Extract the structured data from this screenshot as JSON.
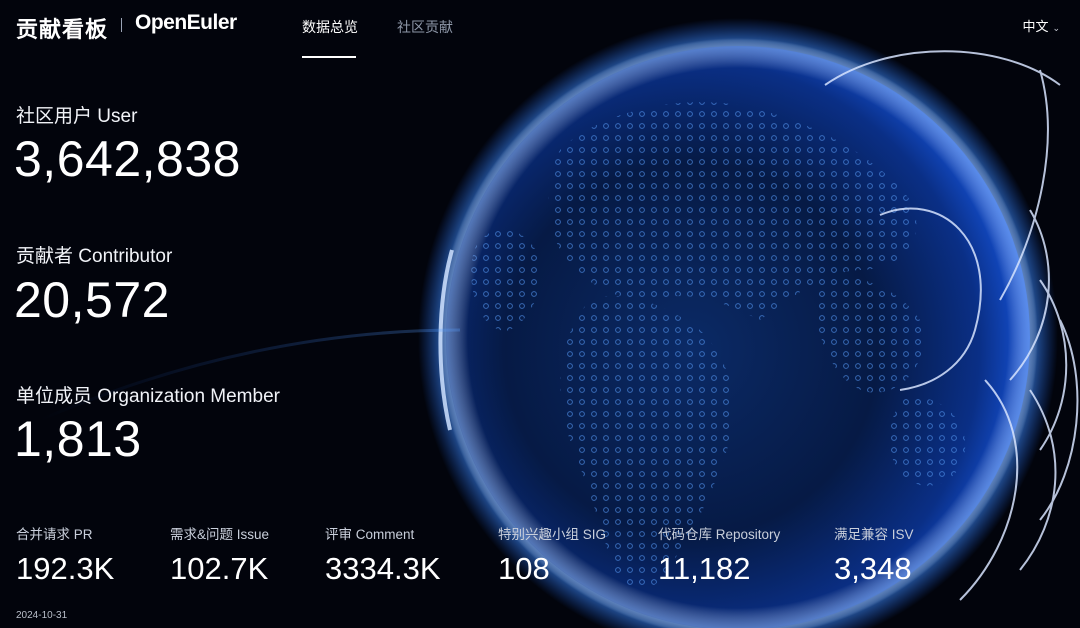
{
  "header": {
    "brand_title": "贡献看板",
    "logo_text": "OpenEuler",
    "tabs": [
      {
        "label": "数据总览",
        "active": true
      },
      {
        "label": "社区贡献",
        "active": false
      }
    ],
    "language": "中文"
  },
  "stats": [
    {
      "label": "社区用户 User",
      "value": "3,642,838"
    },
    {
      "label": "贡献者 Contributor",
      "value": "20,572"
    },
    {
      "label": "单位成员 Organization Member",
      "value": "1,813"
    }
  ],
  "metrics": [
    {
      "label": "合并请求 PR",
      "value": "192.3K"
    },
    {
      "label": "需求&问题 Issue",
      "value": "102.7K"
    },
    {
      "label": "评审 Comment",
      "value": "3334.3K"
    },
    {
      "label": "特别兴趣小组 SIG",
      "value": "108"
    },
    {
      "label": "代码仓库 Repository",
      "value": "11,182"
    },
    {
      "label": "满足兼容 ISV",
      "value": "3,348"
    }
  ],
  "date": "2024-10-31",
  "colors": {
    "background": "#02040c",
    "globe_glow": "#1f6bff",
    "text": "#ffffff",
    "muted": "#8e97a8"
  }
}
